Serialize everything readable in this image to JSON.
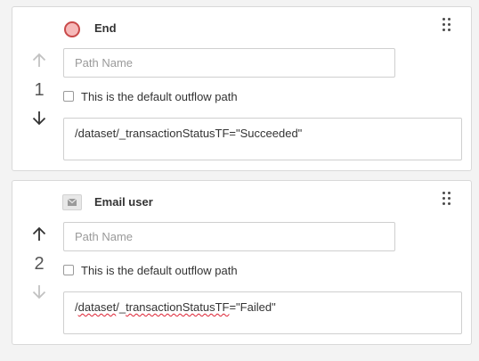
{
  "paths": [
    {
      "title": "End",
      "type_icon": "end-circle-icon",
      "order": "1",
      "path_name": {
        "value": "",
        "placeholder": "Path Name"
      },
      "default_outflow_label": "This is the default outflow path",
      "default_checked": false,
      "condition": "/dataset/_transactionStatusTF=\"Succeeded\"",
      "up_enabled": false,
      "down_enabled": true
    },
    {
      "title": "Email user",
      "type_icon": "envelope-icon",
      "order": "2",
      "path_name": {
        "value": "",
        "placeholder": "Path Name"
      },
      "default_outflow_label": "This is the default outflow path",
      "default_checked": false,
      "condition_parts": [
        "/",
        "dataset",
        "/_",
        "transactionStatusTF",
        "=\"Failed\""
      ],
      "up_enabled": true,
      "down_enabled": false
    }
  ],
  "colors": {
    "arrow_enabled": "#333333",
    "arrow_disabled": "#c2c2c2",
    "end_fill": "#f6b9b9",
    "end_border": "#c94a4a",
    "spellcheck_underline": "#dd2233"
  }
}
